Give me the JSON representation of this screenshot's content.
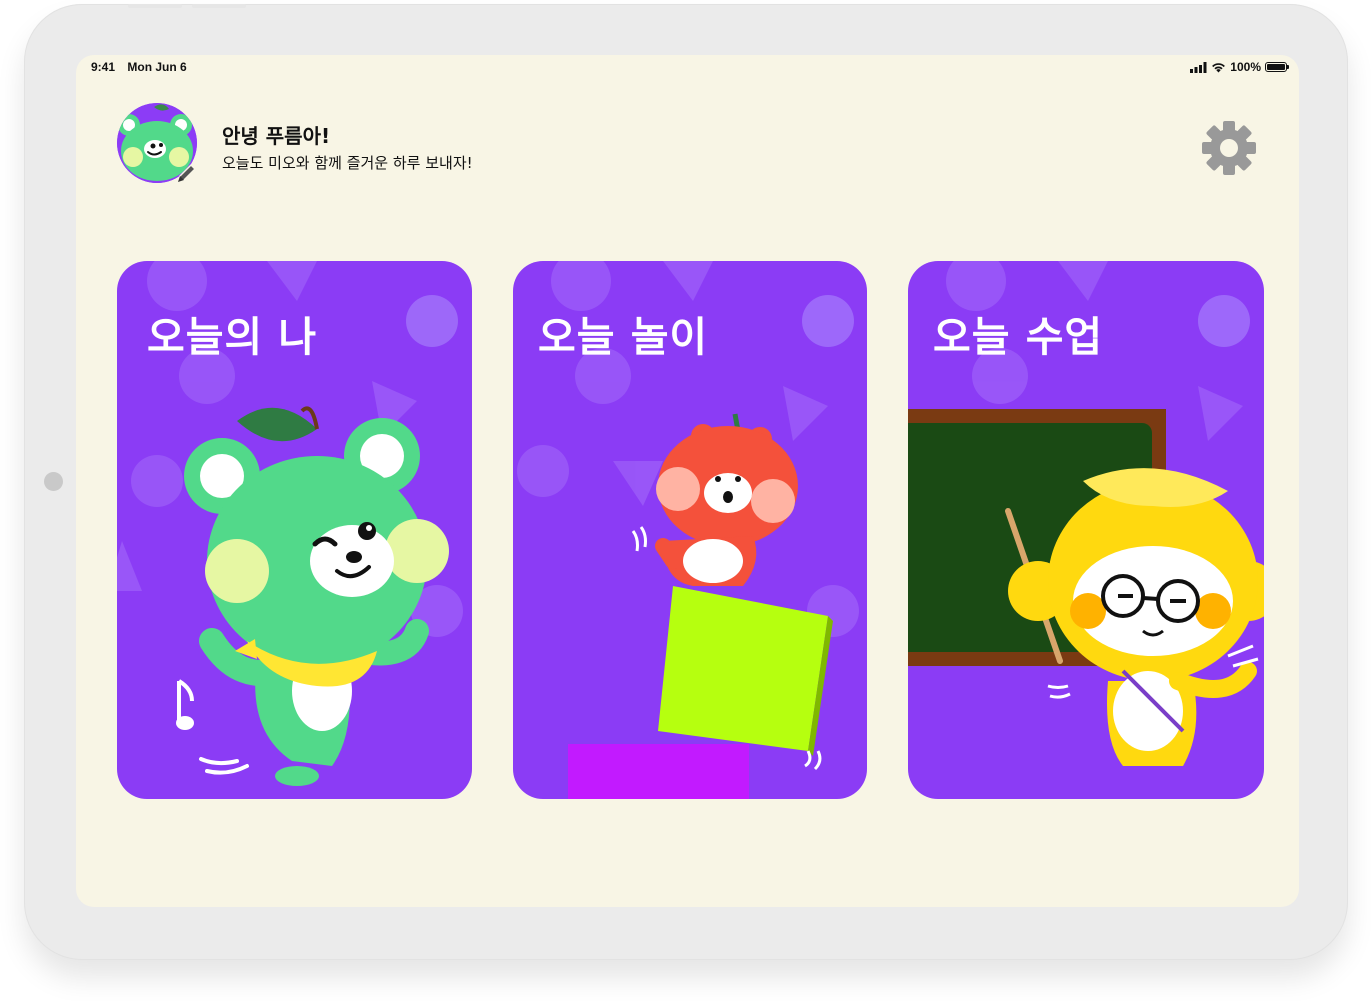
{
  "status_bar": {
    "time": "9:41",
    "date": "Mon Jun 6",
    "battery": "100%"
  },
  "header": {
    "greeting": "안녕 푸름아!",
    "subtitle": "오늘도 미오와 함께 즐거운 하루 보내자!"
  },
  "cards": [
    {
      "title": "오늘의 나",
      "character": "green-bear"
    },
    {
      "title": "오늘 놀이",
      "character": "red-squirrel"
    },
    {
      "title": "오늘 수업",
      "character": "yellow-monkey"
    }
  ],
  "icons": {
    "settings": "gear-icon",
    "edit": "pencil-icon",
    "avatar": "bear-avatar"
  },
  "colors": {
    "screen_bg": "#f8f5e5",
    "card_bg": "#8b3cf5",
    "green_character": "#52d98a",
    "red_character": "#f4513b",
    "yellow_character": "#ffd90f",
    "lime_block": "#b6ff0f",
    "blackboard": "#1a4a14"
  }
}
